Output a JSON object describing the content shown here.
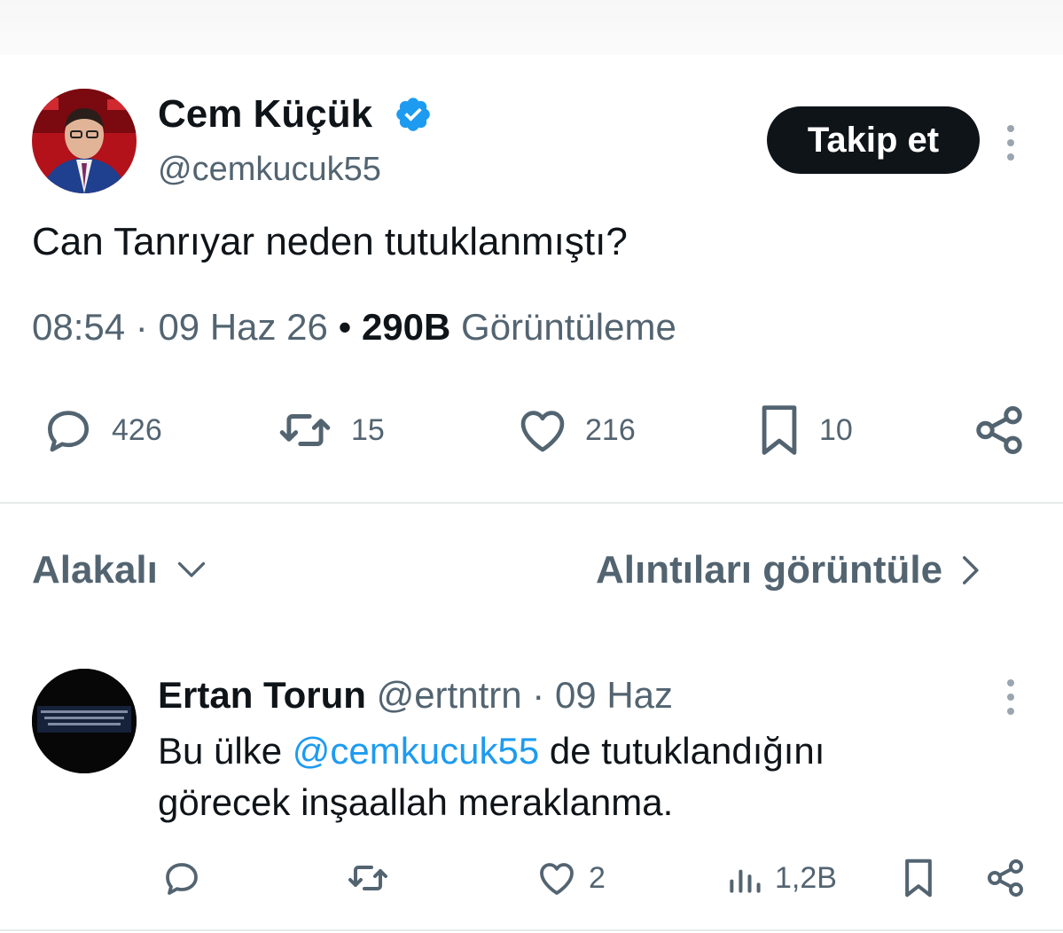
{
  "main_tweet": {
    "author_name": "Cem Küçük",
    "author_handle": "@cemkucuk55",
    "follow_label": "Takip et",
    "text": "Can Tanrıyar neden tutuklanmıştı?",
    "time": "08:54",
    "date": "09 Haz 26",
    "views_count": "290B",
    "views_label": "Görüntüleme",
    "stats": {
      "replies": "426",
      "retweets": "15",
      "likes": "216",
      "bookmarks": "10"
    }
  },
  "sort": {
    "label": "Alakalı",
    "quotes_link": "Alıntıları görüntüle"
  },
  "reply": {
    "author_name": "Ertan Torun",
    "author_handle": "@ertntrn",
    "date": "09 Haz",
    "text_before": "Bu ülke ",
    "mention": "@cemkucuk55",
    "text_after": " de tutuklandığını görecek inşaallah meraklanma.",
    "stats": {
      "likes": "2",
      "views": "1,2B"
    }
  },
  "colors": {
    "accent": "#1d9bf0",
    "text": "#0f1419",
    "muted": "#536471",
    "verified": "#1d9bf0"
  }
}
